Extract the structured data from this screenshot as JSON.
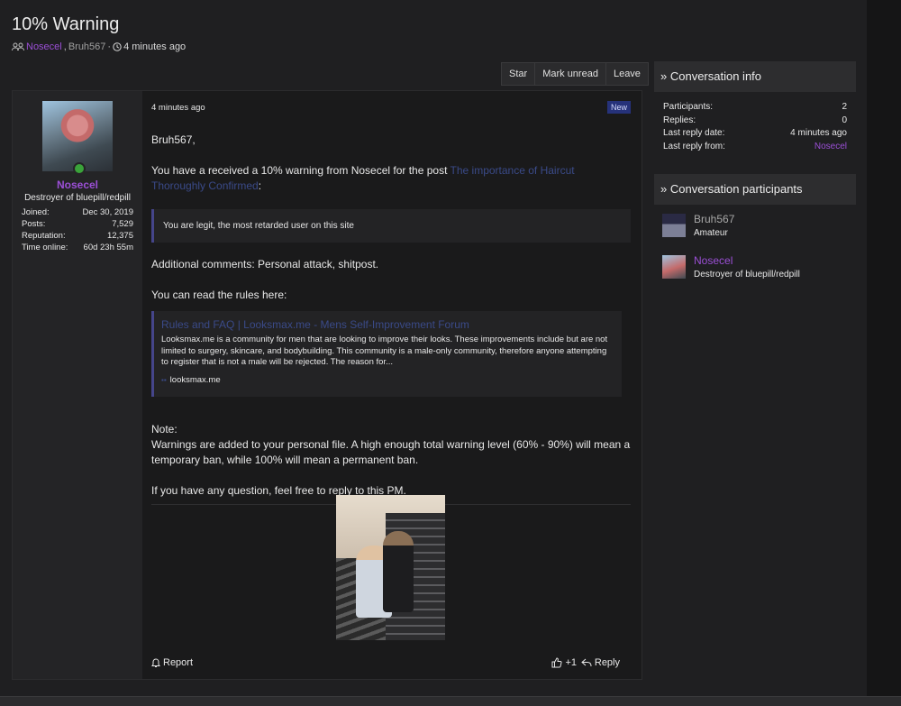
{
  "thread": {
    "title": "10% Warning",
    "participant_1": "Nosecel",
    "participant_sep": ",",
    "participant_2": "Bruh567",
    "dot": "·",
    "time": "4 minutes ago"
  },
  "actions": {
    "star": "Star",
    "mark_unread": "Mark unread",
    "leave": "Leave"
  },
  "author": {
    "name": "Nosecel",
    "title": "Destroyer of bluepill/redpill",
    "stats": [
      {
        "label": "Joined:",
        "value": "Dec 30, 2019"
      },
      {
        "label": "Posts:",
        "value": "7,529"
      },
      {
        "label": "Reputation:",
        "value": "12,375"
      },
      {
        "label": "Time online:",
        "value": "60d 23h 55m"
      }
    ]
  },
  "message": {
    "time": "4 minutes ago",
    "badge": "New",
    "greeting": "Bruh567,",
    "line1_prefix": "You have a received a 10% warning from Nosecel for the post ",
    "line1_link": "The importance of Haircut Thoroughly Confirmed",
    "line1_suffix": ":",
    "quote": "You are legit, the most retarded user on this site",
    "comments": "Additional comments: Personal attack, shitpost.",
    "rules_intro": "You can read the rules here:",
    "unfurl": {
      "title": "Rules and FAQ | Looksmax.me - Mens Self-Improvement Forum",
      "description": "Looksmax.me is a community for men that are looking to improve their looks. These improvements include but are not limited to surgery, skincare, and bodybuilding. This community is a male-only community, therefore anyone attempting to register that is not a male will be rejected. The reason for...",
      "domain": "looksmax.me"
    },
    "note_label": "Note:",
    "note_text": "Warnings are added to your personal file. A high enough total warning level (60% - 90%) will mean a temporary ban, while 100% will mean a permanent ban.",
    "closing": "If you have any question, feel free to reply to this PM.",
    "report": "Report",
    "reactions": "+1",
    "reply": "Reply"
  },
  "conversation_info": {
    "heading": "» Conversation info",
    "rows": [
      {
        "label": "Participants:",
        "value": "2"
      },
      {
        "label": "Replies:",
        "value": "0"
      },
      {
        "label": "Last reply date:",
        "value": "4 minutes ago"
      },
      {
        "label": "Last reply from:",
        "value": "Nosecel"
      }
    ]
  },
  "participants": {
    "heading": "» Conversation participants",
    "items": [
      {
        "name": "Bruh567",
        "title": "Amateur"
      },
      {
        "name": "Nosecel",
        "title": "Destroyer of bluepill/redpill"
      }
    ]
  },
  "colors": {
    "accent_purple": "#9b4fd6",
    "link_blue": "#3a4a88",
    "online_green": "#3aa33a"
  }
}
